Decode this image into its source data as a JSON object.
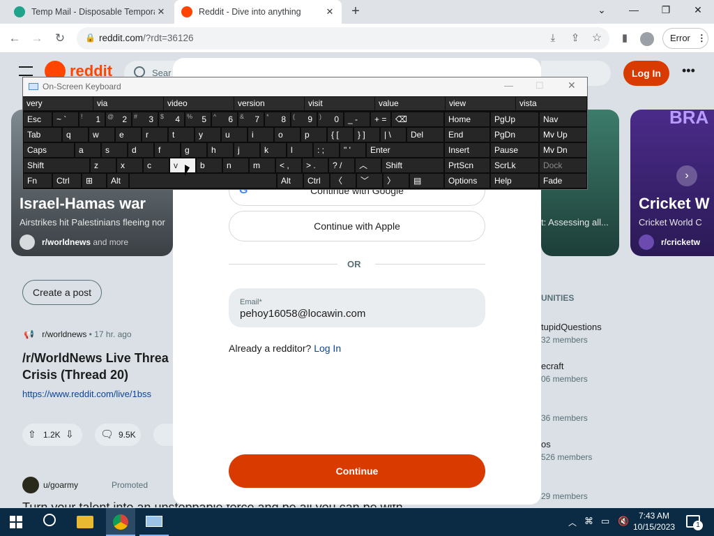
{
  "browser": {
    "tabs": [
      {
        "title": "Temp Mail - Disposable Tempora",
        "favicon_color": "#1fa38a"
      },
      {
        "title": "Reddit - Dive into anything",
        "favicon_color": "#ff4500"
      }
    ],
    "url_host": "reddit.com",
    "url_rest": "/?rdt=36126",
    "error_label": "Error"
  },
  "reddit": {
    "logo_text": "reddit",
    "search_placeholder": "Sear",
    "login_label": "Log In",
    "hero_left": {
      "title": "Israel-Hamas war",
      "subtitle": "Airstrikes hit Palestinians fleeing nor",
      "community": "r/worldnews",
      "more": "and more"
    },
    "hero_mid_subtitle": "t: Assessing all...",
    "hero_right": {
      "title": "Cricket W",
      "subtitle": "Cricket World C",
      "community": "r/cricketw",
      "badge": "BRA"
    },
    "create_post": "Create a post",
    "post": {
      "community": "r/worldnews",
      "age": "17 hr. ago",
      "title_line1": "/r/WorldNews Live Threa",
      "title_line2": "Crisis (Thread 20)",
      "link": "https://www.reddit.com/live/1bss",
      "upvotes": "1.2K",
      "comments": "9.5K"
    },
    "promoted": {
      "user": "u/goarmy",
      "label": "Promoted",
      "text": "Turn your talent into an unstoppable force and be all you can be with"
    },
    "communities_header": "UNITIES",
    "communities": [
      {
        "name": "tupidQuestions",
        "members": "32 members"
      },
      {
        "name": "ecraft",
        "members": "06 members"
      },
      {
        "name": "",
        "members": "36 members"
      },
      {
        "name": "os",
        "members": "526 members"
      },
      {
        "name": "",
        "members": "29 members"
      }
    ]
  },
  "dialog": {
    "google_label": "Continue with Google",
    "apple_label": "Continue with Apple",
    "or_label": "OR",
    "email_label": "Email*",
    "email_value": "pehoy16058@locawin.com",
    "already_text": "Already a redditor?",
    "login_link": "Log In",
    "continue_label": "Continue"
  },
  "osk": {
    "title": "On-Screen Keyboard",
    "predictions": [
      "very",
      "via",
      "video",
      "version",
      "visit",
      "value",
      "view",
      "vista"
    ]
  },
  "taskbar": {
    "time": "7:43 AM",
    "date": "10/15/2023",
    "notification_count": "1"
  }
}
